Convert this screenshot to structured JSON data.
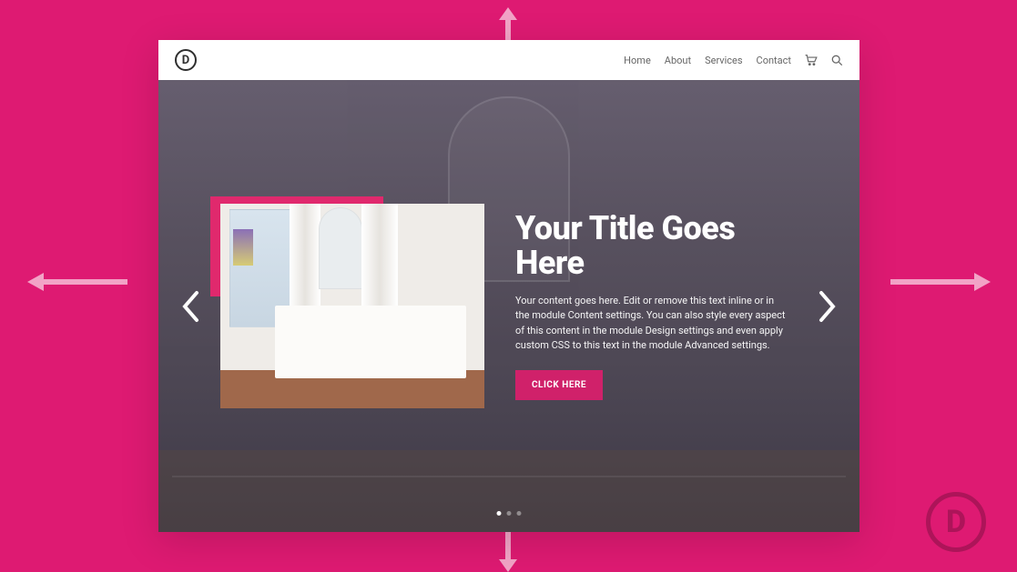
{
  "colors": {
    "canvas_bg": "#de1a72",
    "accent": "#d0216a",
    "text_dark": "#2e2e2e"
  },
  "nav": {
    "items": [
      {
        "label": "Home"
      },
      {
        "label": "About"
      },
      {
        "label": "Services"
      },
      {
        "label": "Contact"
      }
    ]
  },
  "logo": {
    "letter": "D"
  },
  "hero": {
    "title": "Your Title Goes Here",
    "body": "Your content goes here. Edit or remove this text inline or in the module Content settings. You can also style every aspect of this content in the module Design settings and even apply custom CSS to this text in the module Advanced settings.",
    "cta_label": "CLICK HERE",
    "dots_count": 3,
    "active_dot": 0
  },
  "watermark": {
    "letter": "D"
  }
}
